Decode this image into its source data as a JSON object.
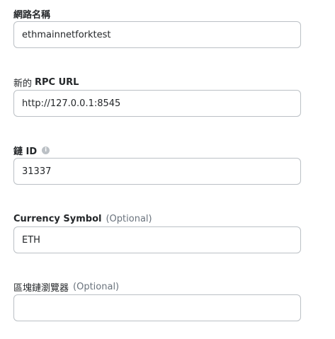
{
  "form": {
    "network_name": {
      "label": "網路名稱",
      "value": "ethmainnetforktest"
    },
    "rpc_url": {
      "label_prefix": "新的 ",
      "label_strong": "RPC URL",
      "value": "http://127.0.0.1:8545"
    },
    "chain_id": {
      "label": "鏈 ID",
      "info_icon": "info-icon",
      "info_glyph": "i",
      "value": "31337"
    },
    "currency_symbol": {
      "label": "Currency Symbol",
      "optional": "(Optional)",
      "value": "ETH"
    },
    "block_explorer": {
      "label": "區塊鏈瀏覽器",
      "optional": "(Optional)",
      "value": ""
    }
  }
}
